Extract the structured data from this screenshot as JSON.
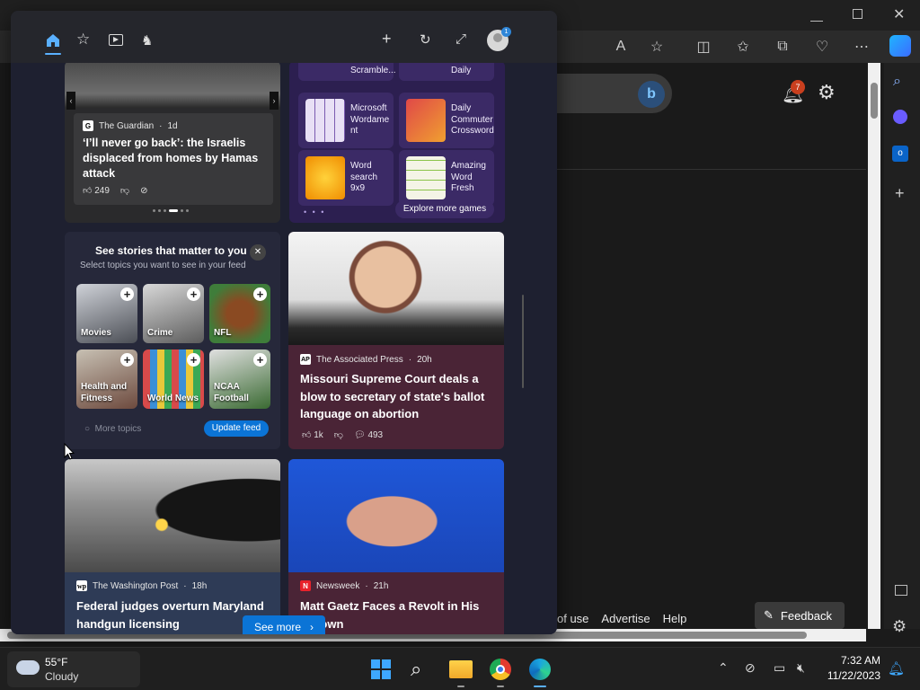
{
  "browser": {
    "toolbar_icons": [
      "read-aloud-icon",
      "add-favorite-icon",
      "split-screen-icon",
      "favorites-icon",
      "collections-icon",
      "browser-essentials-icon",
      "more-icon",
      "copilot-icon"
    ],
    "notifications_count": "7",
    "footer_links": [
      "of use",
      "Advertise",
      "Help"
    ],
    "feedback_label": "Feedback",
    "accent": "#0b74d6"
  },
  "panel": {
    "nav_icons": [
      "home-icon",
      "favorites-icon",
      "video-icon",
      "games-icon"
    ],
    "action_icons": [
      "add-icon",
      "refresh-icon",
      "expand-icon",
      "profile-icon"
    ],
    "featured": {
      "source": "The Guardian",
      "age": "1d",
      "headline": "‘I’ll never go back’: the Israelis displaced from homes by Hamas attack",
      "likes": "249"
    },
    "games": {
      "top_partial": [
        "Scramble...",
        "Daily"
      ],
      "items": [
        {
          "name": "Microsoft Wordame nt"
        },
        {
          "name": "Daily Commuter Crossword"
        },
        {
          "name": "Word search 9x9"
        },
        {
          "name": "Amazing Word Fresh"
        }
      ],
      "explore_label": "Explore more games"
    },
    "topics": {
      "title": "See stories that matter to you",
      "subtitle": "Select topics you want to see in your feed",
      "items": [
        "Movies",
        "Crime",
        "NFL",
        "Health and Fitness",
        "World News",
        "NCAA Football"
      ],
      "more_label": "More topics",
      "update_label": "Update feed"
    },
    "story_ap": {
      "source": "The Associated Press",
      "age": "20h",
      "headline": "Missouri Supreme Court deals a blow to secretary of state's ballot language on abortion",
      "likes": "1k",
      "comments": "493"
    },
    "story_wapo": {
      "source": "The Washington Post",
      "age": "18h",
      "headline": "Federal judges overturn Maryland handgun licensing"
    },
    "story_newsweek": {
      "source": "Newsweek",
      "age": "21h",
      "headline": "Matt Gaetz Faces a Revolt in His ...etown"
    },
    "see_more_label": "See more"
  },
  "taskbar": {
    "weather_temp": "55°F",
    "weather_desc": "Cloudy",
    "time": "7:32 AM",
    "date": "11/22/2023"
  }
}
